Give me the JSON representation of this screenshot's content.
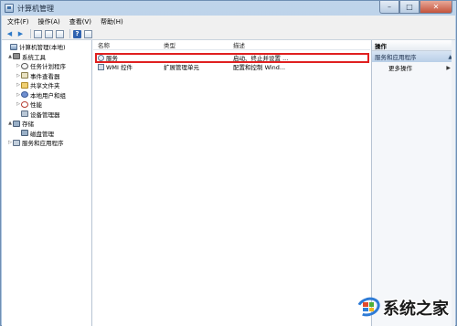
{
  "window": {
    "title": "计算机管理"
  },
  "menu": [
    "文件(F)",
    "操作(A)",
    "查看(V)",
    "帮助(H)"
  ],
  "tree": [
    {
      "label": "计算机管理(本地)",
      "expander": "",
      "icon": "computer-icon",
      "indent": 0
    },
    {
      "label": "系统工具",
      "expander": "▲",
      "icon": "tools-icon",
      "indent": 1
    },
    {
      "label": "任务计划程序",
      "expander": "▷",
      "icon": "clock-icon",
      "indent": 2
    },
    {
      "label": "事件查看器",
      "expander": "▷",
      "icon": "event-log-icon",
      "indent": 2
    },
    {
      "label": "共享文件夹",
      "expander": "▷",
      "icon": "shared-folder-icon",
      "indent": 2
    },
    {
      "label": "本地用户和组",
      "expander": "▷",
      "icon": "users-icon",
      "indent": 2
    },
    {
      "label": "性能",
      "expander": "▷",
      "icon": "performance-icon",
      "indent": 2
    },
    {
      "label": "设备管理器",
      "expander": "",
      "icon": "device-manager-icon",
      "indent": 2
    },
    {
      "label": "存储",
      "expander": "▲",
      "icon": "storage-icon",
      "indent": 1
    },
    {
      "label": "磁盘管理",
      "expander": "",
      "icon": "disk-icon",
      "indent": 2
    },
    {
      "label": "服务和应用程序",
      "expander": "▷",
      "icon": "services-apps-icon",
      "indent": 1
    }
  ],
  "list": {
    "columns": {
      "name": "名称",
      "type": "类型",
      "desc": "描述"
    },
    "rows": [
      {
        "name": "服务",
        "type": "",
        "desc": "启动、终止并设置 ...",
        "icon": "services-icon"
      },
      {
        "name": "WMI 控件",
        "type": "扩展管理单元",
        "desc": "配置和控制 Wind...",
        "icon": "wmi-icon"
      }
    ]
  },
  "actions": {
    "title": "操作",
    "section": "服务和应用程序",
    "more": "更多操作"
  },
  "watermark": {
    "text": "系统之家"
  }
}
